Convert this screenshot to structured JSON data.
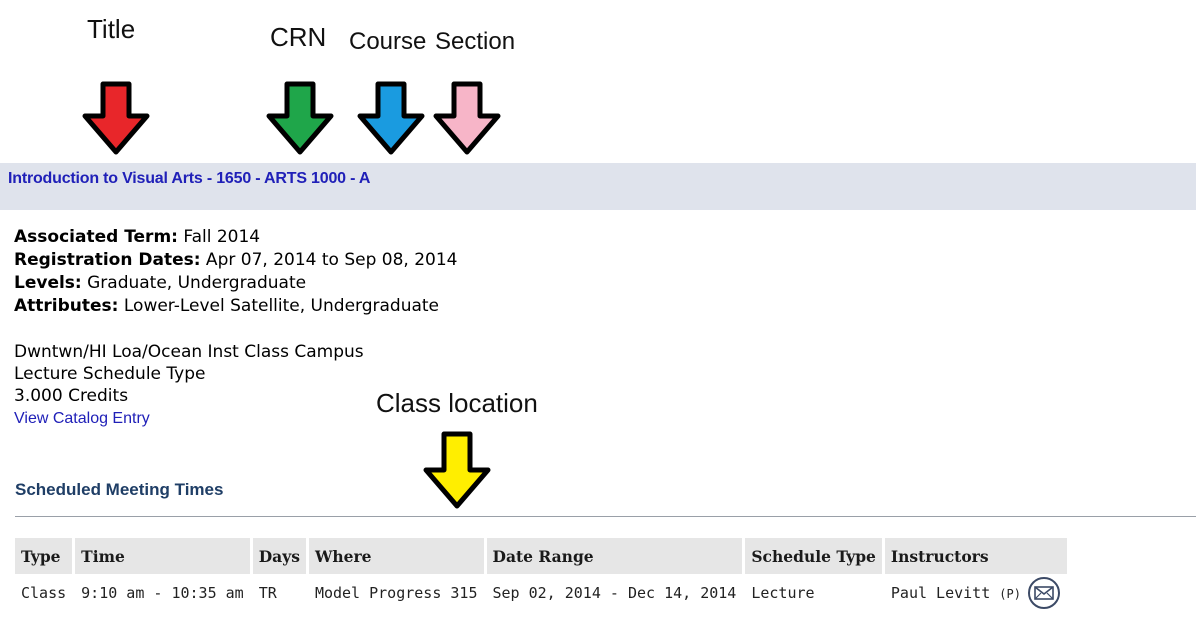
{
  "annotations": {
    "title": "Title",
    "crn": "CRN",
    "course": "Course",
    "section": "Section",
    "class_location": "Class location"
  },
  "arrow_colors": {
    "title": "#e8262a",
    "crn": "#1fa64a",
    "course": "#1a9be0",
    "section": "#f7b5c8",
    "class_location": "#ffee00"
  },
  "course": {
    "heading": "Introduction to Visual Arts - 1650 - ARTS 1000 - A"
  },
  "details": {
    "term_label": "Associated Term:",
    "term_value": " Fall 2014",
    "reg_label": "Registration Dates:",
    "reg_value": " Apr 07, 2014 to Sep 08, 2014",
    "levels_label": "Levels:",
    "levels_value": " Graduate, Undergraduate",
    "attributes_label": "Attributes:",
    "attributes_value": " Lower-Level Satellite, Undergraduate"
  },
  "info": {
    "campus": "Dwntwn/HI Loa/Ocean Inst Class Campus",
    "schedule_type": "Lecture Schedule Type",
    "credits": "3.000 Credits",
    "catalog_link": "View Catalog Entry"
  },
  "meetings": {
    "title": "Scheduled Meeting Times",
    "headers": [
      "Type",
      "Time",
      "Days",
      "Where",
      "Date Range",
      "Schedule Type",
      "Instructors"
    ],
    "rows": [
      {
        "type": "Class",
        "time": "9:10 am - 10:35 am",
        "days": "TR",
        "where": "Model Progress 315",
        "date_range": "Sep 02, 2014 - Dec 14, 2014",
        "schedule_type": "Lecture",
        "instructor": "Paul Levitt",
        "primary_mark": "(P)",
        "email_icon": "envelope-icon"
      }
    ]
  }
}
